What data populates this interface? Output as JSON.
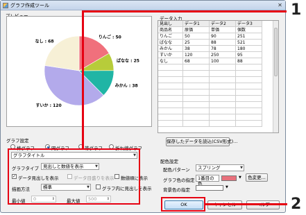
{
  "window": {
    "title": "グラフ作成ツール",
    "close_glyph": "✕"
  },
  "preview": {
    "label": "プレビュー",
    "slices": [
      {
        "name": "りんご",
        "value": 50,
        "label": "りんご : 50",
        "color": "#f0707c"
      },
      {
        "name": "ばなな",
        "value": 25,
        "label": "ばなな : 25",
        "color": "#b7cc3a"
      },
      {
        "name": "みかん",
        "value": 38,
        "label": "みかん : 38",
        "color": "#20b5a5"
      },
      {
        "name": "すいか",
        "value": 120,
        "label": "すいか : 120",
        "color": "#b3aaeb"
      },
      {
        "name": "なし",
        "value": 68,
        "label": "なし : 68",
        "color": "#f7f0d6"
      }
    ]
  },
  "data_input": {
    "label": "データ入力",
    "headers": [
      "見出し",
      "データ1",
      "データ2",
      "データ3"
    ],
    "rows": [
      [
        "商品名",
        "原価",
        "単価",
        "個数"
      ],
      [
        "りんご",
        "50",
        "90",
        "251"
      ],
      [
        "ばなな",
        "25",
        "88",
        "521"
      ],
      [
        "みかん",
        "38",
        "78",
        "180"
      ],
      [
        "すいか",
        "120",
        "250",
        "95"
      ],
      [
        "なし",
        "68",
        "100",
        "88"
      ]
    ],
    "save_button": "保存したデータを読込(CSV形式)..."
  },
  "graph_settings": {
    "label": "グラフ設定",
    "types": [
      "棒グラフ",
      "円グラフ",
      "帯グラフ",
      "折れ線グラフ"
    ],
    "selected_type": "円グラフ",
    "title_value": "グラフタイトル",
    "graph_type_label": "グラフタイプ",
    "graph_type_value": "見出しと数値を表示",
    "check_data_label": "データ見出しを表示",
    "check_data_points": "データ目盛りを表示",
    "check_sort": "数値順に表示",
    "draw_method_label": "描画方法",
    "draw_method_value": "標準",
    "check_graph_label": "グラフ内に見出しを表示",
    "min_label": "最小値",
    "min_value": "0",
    "max_label": "最大値",
    "max_value": "500"
  },
  "color_settings": {
    "label": "配色設定",
    "pattern_label": "配色パターン",
    "pattern_value": "スプリング",
    "graph_color_label": "グラフ色の指定",
    "graph_color_value": "1番目の色",
    "graph_color_swatch": "#e8707c",
    "color_change_button": "色変更...",
    "bg_color_label": "背景色の指定",
    "bg_color_swatch": "#ffffff"
  },
  "footer": {
    "ok": "OK",
    "cancel": "キャンセル",
    "help": "ヘルプ"
  },
  "callouts": {
    "one": "1",
    "two": "2",
    "accent": "#e60012"
  }
}
